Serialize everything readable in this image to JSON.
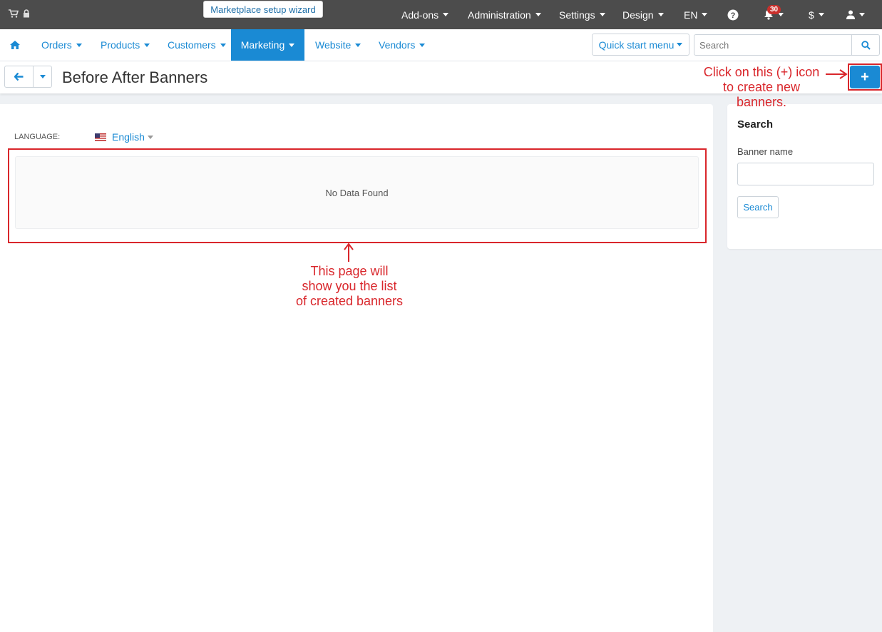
{
  "topbar": {
    "wizard": "Marketplace setup wizard",
    "menus": [
      "Add-ons",
      "Administration",
      "Settings",
      "Design",
      "EN"
    ],
    "notification_count": "30",
    "currency": "$"
  },
  "nav": {
    "items": [
      "Orders",
      "Products",
      "Customers",
      "Marketing",
      "Website",
      "Vendors"
    ],
    "active": "Marketing",
    "quick_start": "Quick start menu",
    "search_placeholder": "Search"
  },
  "page": {
    "title": "Before After Banners",
    "language_label": "LANGUAGE:",
    "language_value": "English",
    "empty_message": "No Data Found"
  },
  "sidebar": {
    "title": "Search",
    "field_label": "Banner name",
    "button": "Search"
  },
  "annotations": {
    "add_hint_line1": "Click on this (+) icon",
    "add_hint_line2": "to create new",
    "add_hint_line3": "banners.",
    "list_hint_line1": "This page will",
    "list_hint_line2": "show you the list",
    "list_hint_line3": "of created banners"
  },
  "colors": {
    "accent": "#1a8ad4",
    "topbar": "#4c4c4c",
    "annotation": "#d9262b"
  },
  "icons": [
    "cart-icon",
    "lock-icon",
    "help-icon",
    "bell-icon",
    "user-icon",
    "home-icon",
    "search-icon",
    "back-arrow-icon",
    "plus-icon"
  ]
}
